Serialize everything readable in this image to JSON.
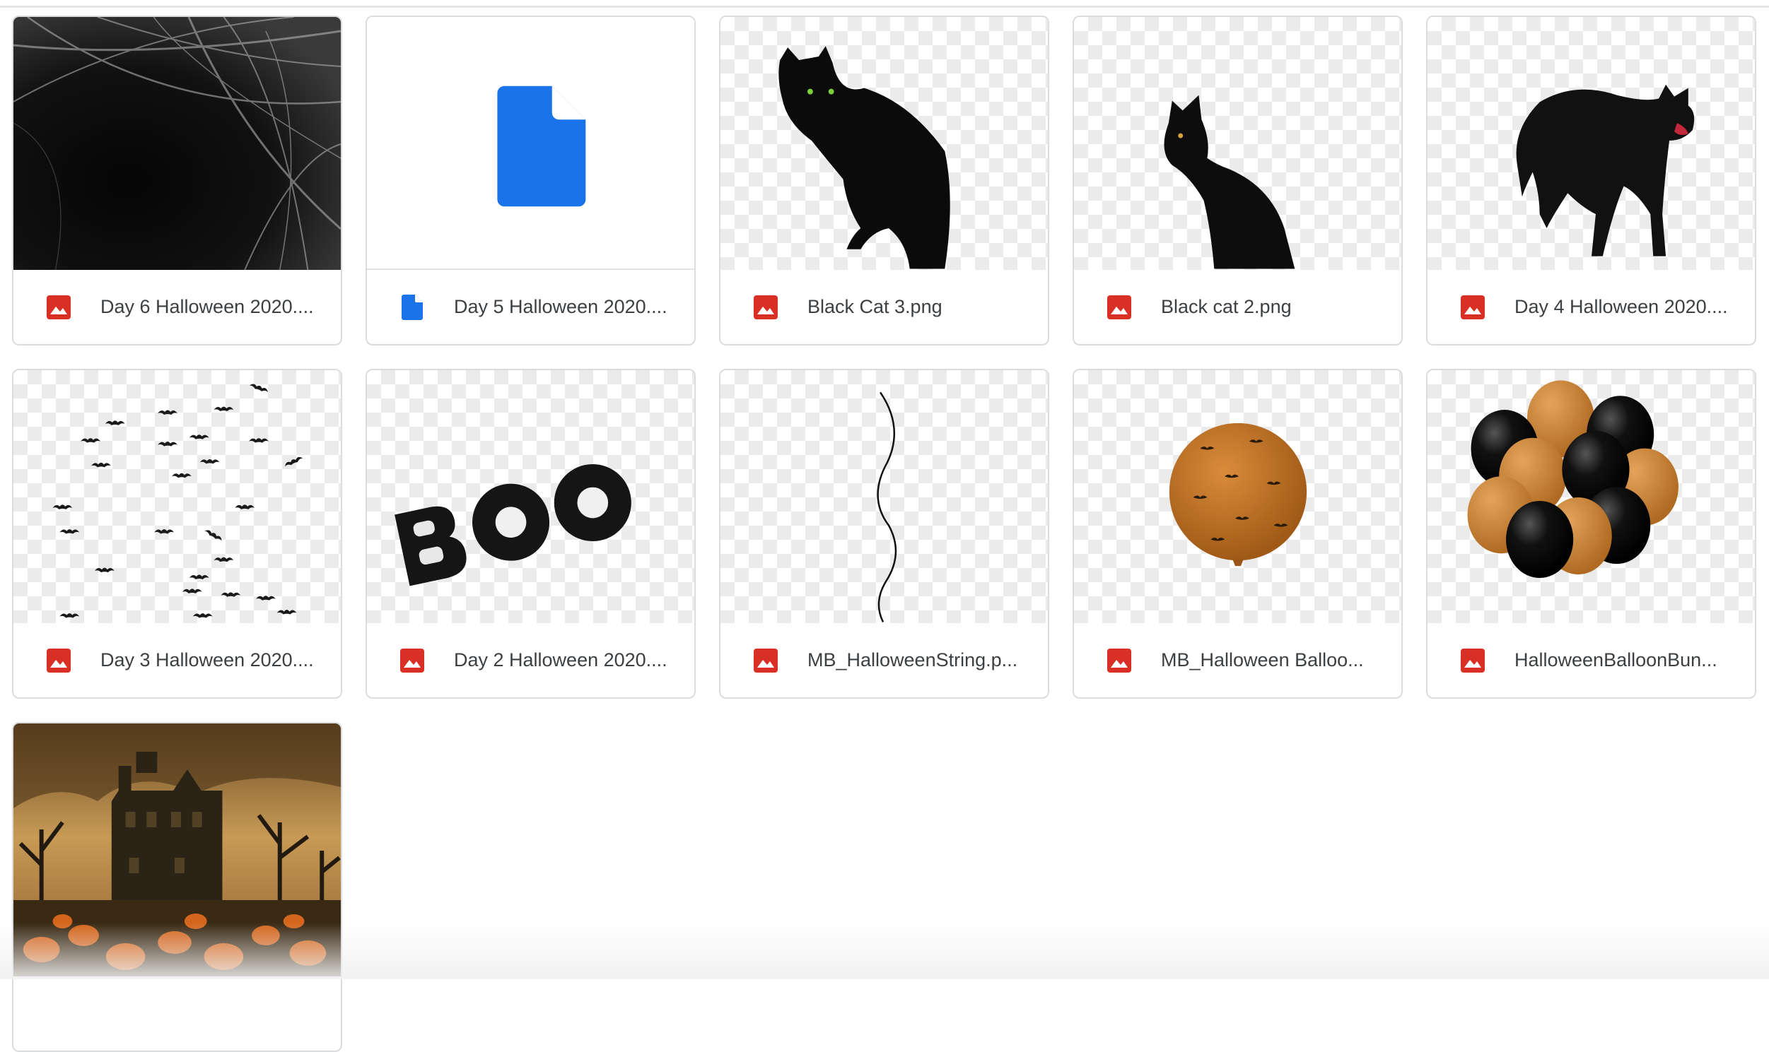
{
  "files": [
    {
      "name": "Day 6 Halloween 2020....",
      "type": "image",
      "thumbnail": "spider-web"
    },
    {
      "name": "Day 5 Halloween 2020....",
      "type": "document",
      "thumbnail": "doc-icon"
    },
    {
      "name": "Black Cat 3.png",
      "type": "image",
      "thumbnail": "black-cat-sitting"
    },
    {
      "name": "Black cat 2.png",
      "type": "image",
      "thumbnail": "black-cat-profile"
    },
    {
      "name": "Day 4 Halloween 2020....",
      "type": "image",
      "thumbnail": "black-cat-arched"
    },
    {
      "name": "Day 3 Halloween 2020....",
      "type": "image",
      "thumbnail": "bats"
    },
    {
      "name": "Day 2 Halloween 2020....",
      "type": "image",
      "thumbnail": "boo-letters"
    },
    {
      "name": "MB_HalloweenString.p...",
      "type": "image",
      "thumbnail": "string"
    },
    {
      "name": "MB_Halloween Balloo...",
      "type": "image",
      "thumbnail": "orange-balloon"
    },
    {
      "name": "HalloweenBalloonBun...",
      "type": "image",
      "thumbnail": "balloon-bunch"
    },
    {
      "name": "",
      "type": "image",
      "thumbnail": "haunted-house"
    }
  ],
  "colors": {
    "image_icon": "#d93025",
    "doc_icon": "#1a73e8",
    "card_border": "#dadce0",
    "text": "#3c4043"
  }
}
